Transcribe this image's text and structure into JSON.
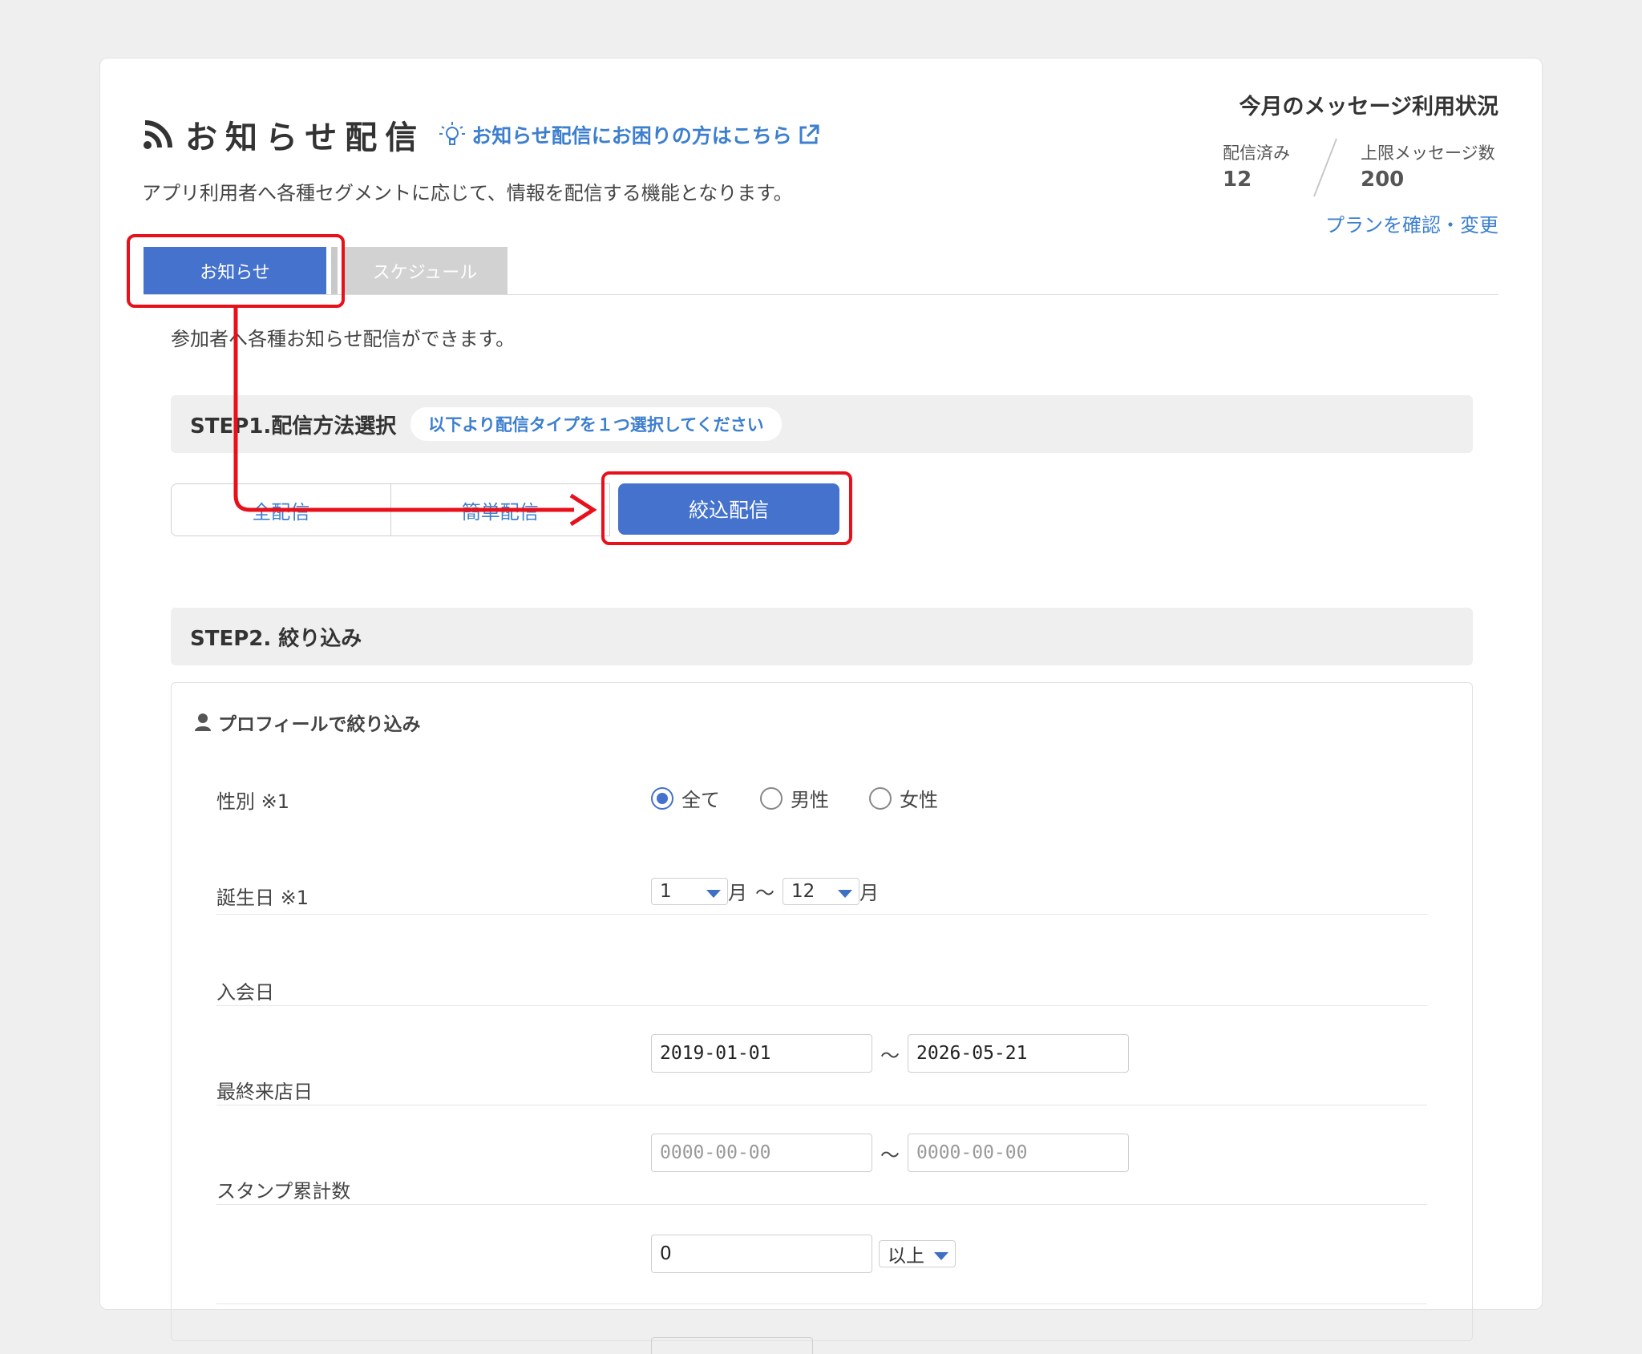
{
  "header": {
    "title": "お知らせ配信",
    "help_link": "お知らせ配信にお困りの方はこちら",
    "subtitle": "アプリ利用者へ各種セグメントに応じて、情報を配信する機能となります。"
  },
  "usage": {
    "title": "今月のメッセージ利用状況",
    "sent_label": "配信済み",
    "sent_value": "12",
    "limit_label": "上限メッセージ数",
    "limit_value": "200",
    "plan_link": "プランを確認・変更"
  },
  "tabs": [
    {
      "label": "お知らせ",
      "active": true
    },
    {
      "label": "スケジュール",
      "active": false
    }
  ],
  "tab_description": "参加者へ各種お知らせ配信ができます。",
  "step1": {
    "title": "STEP1.配信方法選択",
    "hint": "以下より配信タイプを１つ選択してください",
    "options": [
      "全配信",
      "簡単配信",
      "絞込配信"
    ],
    "selected": "絞込配信"
  },
  "step2": {
    "title": "STEP2. 絞り込み",
    "section_title": "プロフィールで絞り込み",
    "gender": {
      "label": "性別 ※1",
      "options": [
        "全て",
        "男性",
        "女性"
      ],
      "selected": "全て"
    },
    "birthday": {
      "label": "誕生日 ※1",
      "from": "1",
      "to": "12",
      "unit": "月",
      "tilde": "〜"
    },
    "join_date": {
      "label": "入会日",
      "from": "2019-01-01",
      "to": "2026-05-21",
      "tilde": "〜"
    },
    "last_visit": {
      "label": "最終来店日",
      "from_placeholder": "0000-00-00",
      "to_placeholder": "0000-00-00",
      "tilde": "〜"
    },
    "stamp_count": {
      "label": "スタンプ累計数",
      "value": "0",
      "condition": "以上"
    }
  },
  "colors": {
    "accent": "#4472cc",
    "link": "#3d7fcf",
    "annotation": "#e8101a"
  }
}
